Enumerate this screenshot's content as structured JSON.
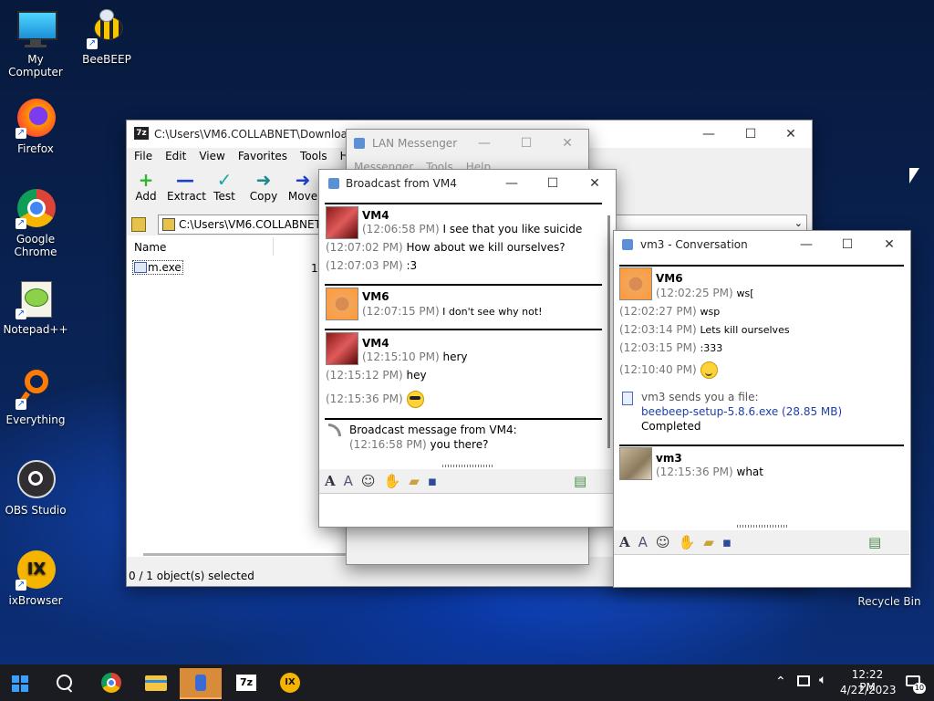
{
  "desktop": {
    "icons": [
      {
        "label": "My Computer"
      },
      {
        "label": "BeeBEEP"
      },
      {
        "label": "Firefox"
      },
      {
        "label": "Google Chrome"
      },
      {
        "label": "Notepad++"
      },
      {
        "label": "Everything"
      },
      {
        "label": "OBS Studio"
      },
      {
        "label": "ixBrowser"
      },
      {
        "label": "Recycle Bin"
      }
    ]
  },
  "sevenzip": {
    "title": "C:\\Users\\VM6.COLLABNET\\Downloads\\53.6.0.1.1",
    "menu": [
      "File",
      "Edit",
      "View",
      "Favorites",
      "Tools",
      "Help"
    ],
    "toolbar": [
      "Add",
      "Extract",
      "Test",
      "Copy",
      "Move"
    ],
    "address": "C:\\Users\\VM6.COLLABNET\\D",
    "column_name": "Name",
    "column_size_fragment": "12",
    "file": "m.exe",
    "status": "0 / 1 object(s) selected"
  },
  "lanmessenger": {
    "title": "LAN Messenger",
    "menu": [
      "Messenger",
      "Tools",
      "Help"
    ]
  },
  "broadcast": {
    "title": "Broadcast from VM4",
    "messages": [
      {
        "user": "VM4",
        "lines": [
          {
            "time": "(12:06:58 PM)",
            "text": "I see that you like suicide"
          },
          {
            "time": "(12:07:02 PM)",
            "text": "How about we kill ourselves?"
          },
          {
            "time": "(12:07:03 PM)",
            "text": ":3"
          }
        ]
      },
      {
        "user": "VM6",
        "lines": [
          {
            "time": "(12:07:15 PM)",
            "text": "I don't see why not!"
          }
        ]
      },
      {
        "user": "VM4",
        "lines": [
          {
            "time": "(12:15:10 PM)",
            "text": "hery"
          },
          {
            "time": "(12:15:12 PM)",
            "text": "hey"
          },
          {
            "time": "(12:15:36 PM)",
            "text": ""
          }
        ]
      }
    ],
    "broadcast_header": "Broadcast message from VM4:",
    "broadcast_time": "(12:16:58 PM)",
    "broadcast_text": "you there?"
  },
  "conversation": {
    "title": "vm3 - Conversation",
    "messages": [
      {
        "user": "VM6",
        "lines": [
          {
            "time": "(12:02:25 PM)",
            "text": "ws["
          },
          {
            "time": "(12:02:27 PM)",
            "text": "wsp"
          },
          {
            "time": "(12:03:14 PM)",
            "text": "Lets kill ourselves"
          },
          {
            "time": "(12:03:15 PM)",
            "text": ":333"
          },
          {
            "time": "(12:10:40 PM)",
            "text": ""
          }
        ]
      },
      {
        "user": "vm3",
        "lines": [
          {
            "time": "(12:15:36 PM)",
            "text": "what"
          }
        ]
      }
    ],
    "file_notice": "vm3 sends you a file:",
    "file_link": "beebeep-setup-5.8.6.exe (28.85 MB)",
    "file_status": "Completed"
  },
  "taskbar": {
    "time": "12:22 PM",
    "date": "4/22/2023",
    "notif_count": "10",
    "apps": [
      "start-icon",
      "search-icon",
      "chrome-icon",
      "file-explorer-icon",
      "lan-messenger-icon",
      "7zip-icon",
      "ixbrowser-icon"
    ]
  }
}
